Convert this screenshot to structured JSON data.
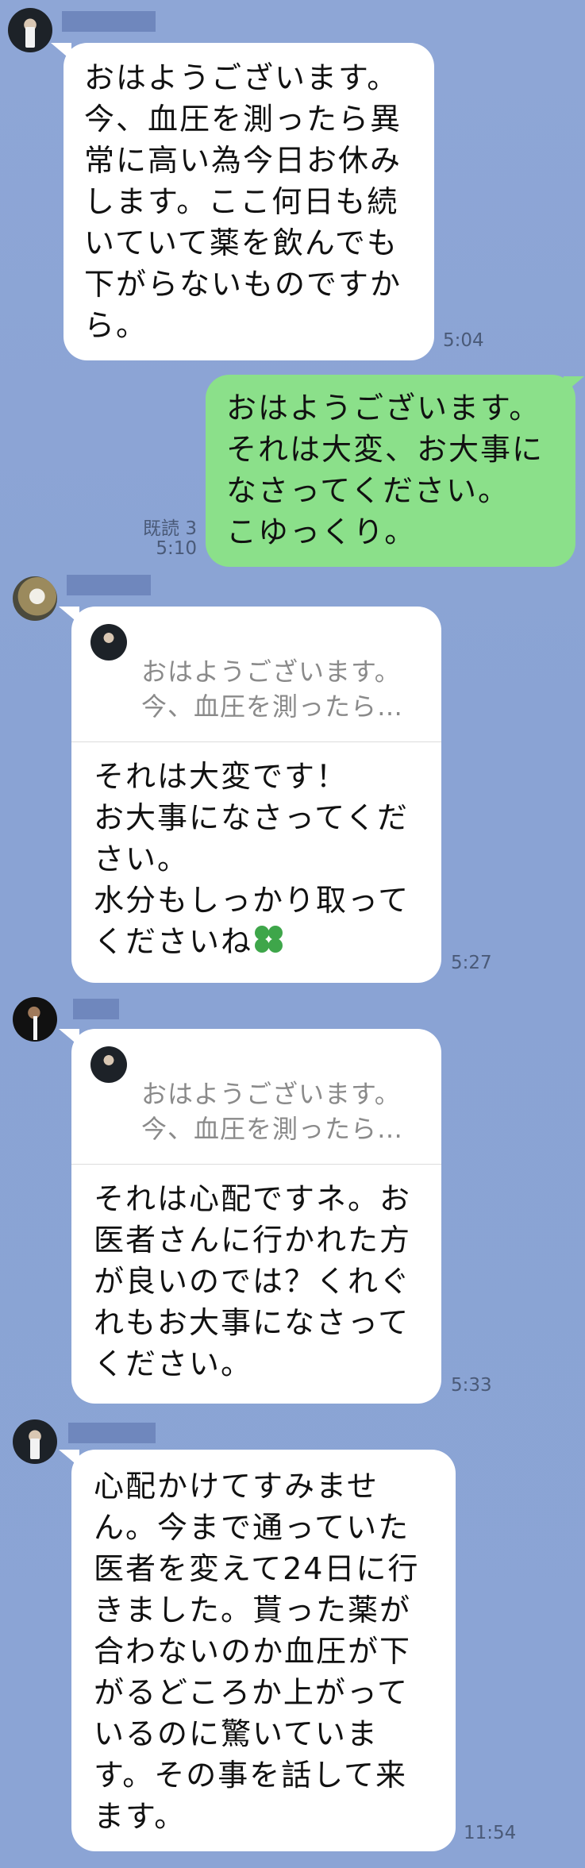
{
  "messages": [
    {
      "text": "おはようございます。\n今、血圧を測ったら異\n常に高い為今日お休み\nします。ここ何日も続\nいていて薬を飲んでも\n下がらないものですか\nら。",
      "time": "5:04"
    },
    {
      "text": "おはようございます。\nそれは大変、お大事に\nなさってください。\nこゆっくり。",
      "read": "既読 3",
      "time": "5:10"
    },
    {
      "quote": "おはようございます。\n今、血圧を測ったら…",
      "text": "それは大変です！\nお大事になさってくだ\nさい。\n水分もしっかり取って\nくださいね",
      "emoji": "four-leaf-clover",
      "time": "5:27"
    },
    {
      "quote": "おはようございます。\n今、血圧を測ったら…",
      "text": "それは心配ですネ。お\n医者さんに行かれた方\nが良いのでは？くれぐ\nれもお大事になさって\nください。",
      "time": "5:33"
    },
    {
      "text": "心配かけてすみませ\nん。今まで通っていた\n医者を変えて24日に行\nきました。貰った薬が\n合わないのか血圧が下\nがるどころか上がって\nいるのに驚いていま\nす。その事を話して来\nます。",
      "time": "11:54"
    }
  ],
  "colors": {
    "background": "#8ea6d6",
    "incoming_bubble": "#ffffff",
    "outgoing_bubble": "#8be08a",
    "name_redaction": "#6f87bd"
  }
}
